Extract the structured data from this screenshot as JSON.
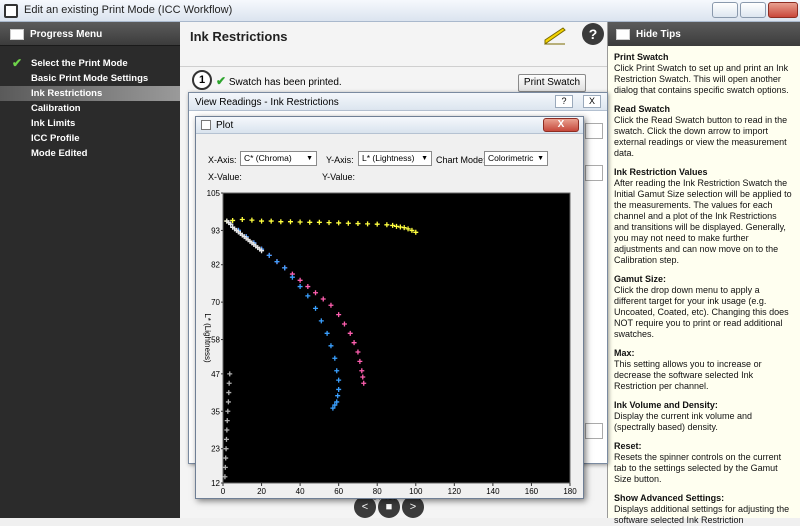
{
  "window": {
    "title": "Edit an existing Print Mode (ICC Workflow)"
  },
  "left": {
    "header": "Progress Menu",
    "items": [
      {
        "label": "Select the Print Mode",
        "done": true
      },
      {
        "label": "Basic Print Mode Settings",
        "done": false
      },
      {
        "label": "Ink Restrictions",
        "done": false,
        "active": true
      },
      {
        "label": "Calibration",
        "done": false
      },
      {
        "label": "Ink Limits",
        "done": false
      },
      {
        "label": "ICC Profile",
        "done": false
      },
      {
        "label": "Mode Edited",
        "done": false
      }
    ]
  },
  "main": {
    "title": "Ink Restrictions",
    "step": "1",
    "swatch_msg": "Swatch has been printed.",
    "print_swatch": "Print Swatch",
    "help": "?"
  },
  "view_readings": {
    "title": "View Readings - Ink Restrictions",
    "help": "?",
    "close": "X"
  },
  "plot": {
    "title": "Plot",
    "close": "X",
    "x_axis_label": "X-Axis:",
    "x_axis_value": "C* (Chroma)",
    "y_axis_label": "Y-Axis:",
    "y_axis_value": "L* (Lightness)",
    "chart_mode_label": "Chart Mode:",
    "chart_mode_value": "Colorimetric",
    "x_value_label": "X-Value:",
    "y_value_label": "Y-Value:"
  },
  "right": {
    "header": "Hide Tips",
    "tips": [
      {
        "title": "Print Swatch",
        "body": "Click Print Swatch to set up and print an Ink Restriction Swatch. This will open another dialog that contains specific swatch options."
      },
      {
        "title": "Read Swatch",
        "body": "Click the Read Swatch button to read in the swatch. Click the down arrow to import external readings or view the measurement data."
      },
      {
        "title": "Ink Restriction Values",
        "body": "After reading the Ink Restriction Swatch the Initial Gamut Size selection will be applied to the measurements. The values for each channel and a plot of the Ink Restrictions and transitions will be displayed. Generally, you may not need to make further adjustments and can now move on to the Calibration step."
      },
      {
        "title": "Gamut Size:",
        "body": "Click the drop down menu to apply a different target for your ink usage (e.g. Uncoated, Coated, etc). Changing this does NOT require you to print or read additional swatches."
      },
      {
        "title": "Max:",
        "body": "This setting allows you to increase or decrease the software selected Ink Restriction per channel."
      },
      {
        "title": "Ink Volume and Density:",
        "body": "Display the current ink volume and (spectrally based) density."
      },
      {
        "title": "Reset:",
        "body": "Resets the spinner controls on the current tab to the settings selected by the Gamut Size button."
      },
      {
        "title": "Show Advanced Settings:",
        "body": "Displays additional settings for adjusting the software selected Ink Restriction"
      }
    ]
  },
  "nav": {
    "prev": "<",
    "stop": "■",
    "next": ">"
  },
  "chart_data": {
    "type": "scatter",
    "xlabel": "C* (Chroma)",
    "ylabel": "L* (Lightness)",
    "xlim": [
      0,
      180
    ],
    "ylim": [
      12,
      105
    ],
    "xticks": [
      0,
      20,
      40,
      60,
      80,
      100,
      120,
      140,
      160,
      180
    ],
    "yticks": [
      12,
      23,
      35,
      47,
      58,
      70,
      82,
      93,
      105
    ],
    "background": "#000000",
    "series": [
      {
        "color": "#ffff40",
        "x": [
          2,
          5,
          10,
          15,
          20,
          25,
          30,
          35,
          40,
          45,
          50,
          55,
          60,
          65,
          70,
          75,
          80,
          85,
          88,
          90,
          92,
          94,
          96,
          98,
          100
        ],
        "y": [
          96,
          96.2,
          96.5,
          96.3,
          96,
          96,
          95.8,
          95.8,
          95.7,
          95.6,
          95.6,
          95.5,
          95.4,
          95.3,
          95.2,
          95.1,
          95,
          94.8,
          94.6,
          94.3,
          94.1,
          93.9,
          93.5,
          93,
          92.4
        ]
      },
      {
        "color": "#ff5fb0",
        "x": [
          4,
          8,
          12,
          16,
          20,
          24,
          28,
          32,
          36,
          40,
          44,
          48,
          52,
          56,
          60,
          63,
          66,
          68,
          70,
          71,
          72,
          72.5,
          73
        ],
        "y": [
          95,
          93,
          91,
          89,
          87,
          85,
          83,
          81,
          79,
          77,
          75,
          73,
          71,
          69,
          66,
          63,
          60,
          57,
          54,
          51,
          48,
          46,
          44
        ]
      },
      {
        "color": "#3aa0ff",
        "x": [
          4,
          8,
          12,
          16,
          20,
          24,
          28,
          32,
          36,
          40,
          44,
          48,
          51,
          54,
          56,
          58,
          59,
          60,
          60,
          59.5,
          59,
          58,
          57
        ],
        "y": [
          95,
          93,
          91,
          89,
          87,
          85,
          83,
          81,
          78,
          75,
          72,
          68,
          64,
          60,
          56,
          52,
          48,
          45,
          42,
          40,
          38,
          37,
          36
        ]
      },
      {
        "color": "#e6e6e6",
        "x": [
          2,
          3,
          4,
          5,
          6,
          7,
          8,
          9,
          10,
          11,
          12,
          13,
          14,
          15,
          16,
          17,
          18,
          19,
          20
        ],
        "y": [
          96,
          95.5,
          95,
          94,
          93.5,
          93,
          92.5,
          92,
          91.5,
          91,
          90.5,
          90,
          89.5,
          89,
          88.5,
          88,
          87.5,
          87,
          86.5
        ]
      },
      {
        "color": "#b0b0b0",
        "x": [
          1,
          1.2,
          1.4,
          1.6,
          1.8,
          2,
          2.2,
          2.5,
          2.8,
          3,
          3.2,
          3.5
        ],
        "y": [
          14,
          17,
          20,
          23,
          26,
          29,
          32,
          35,
          38,
          41,
          44,
          47
        ]
      }
    ]
  }
}
